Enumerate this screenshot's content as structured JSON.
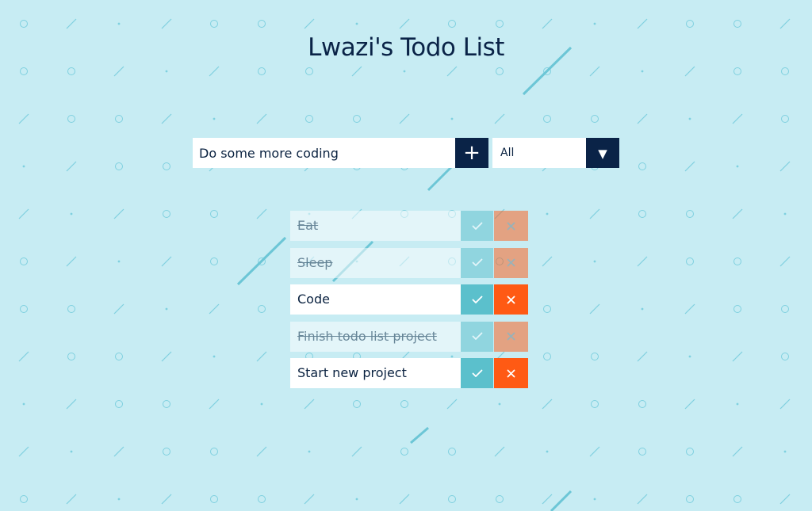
{
  "page": {
    "title": "Lwazi's Todo List"
  },
  "form": {
    "input_value": "Do some more coding",
    "add_button_label": "+",
    "filter_selected": "All",
    "filter_arrow": "▼"
  },
  "todos": [
    {
      "text": "Eat",
      "completed": true
    },
    {
      "text": "Sleep",
      "completed": true
    },
    {
      "text": "Code",
      "completed": false
    },
    {
      "text": "Finish todo list project",
      "completed": true
    },
    {
      "text": "Start new project",
      "completed": false
    }
  ],
  "icons": {
    "complete": "check-icon",
    "delete": "close-icon",
    "add": "plus-icon",
    "dropdown": "caret-down-icon"
  },
  "colors": {
    "background": "#c7ecf3",
    "pattern": "#7fd0df",
    "navy": "#0a2347",
    "complete": "#5bc0cc",
    "delete": "#ff5a14",
    "item": "#ffffff"
  }
}
